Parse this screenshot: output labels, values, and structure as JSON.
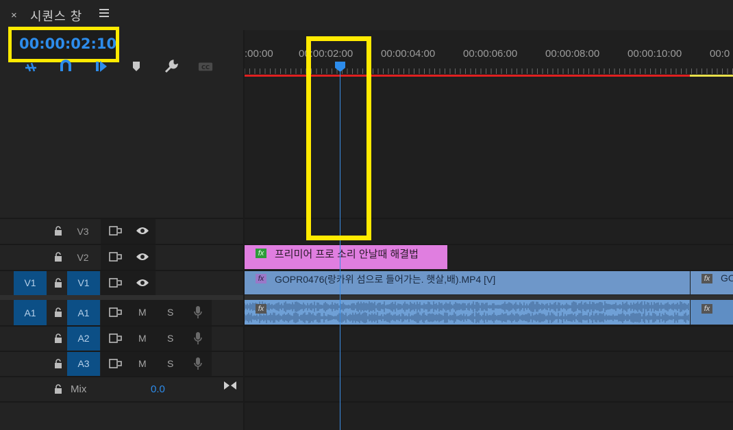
{
  "panel": {
    "close_label": "×",
    "title": "시퀀스 창",
    "timecode": "00:00:02:10"
  },
  "ruler": {
    "labels": [
      ":00:00",
      "00:00:02:00",
      "00:00:04:00",
      "00:00:06:00",
      "00:00:08:00",
      "00:00:10:00",
      "00:0"
    ]
  },
  "tracks": {
    "v3": {
      "name": "V3"
    },
    "v2": {
      "name": "V2"
    },
    "v1": {
      "target": "V1",
      "name": "V1"
    },
    "a1": {
      "target": "A1",
      "name": "A1",
      "mute": "M",
      "solo": "S"
    },
    "a2": {
      "name": "A2",
      "mute": "M",
      "solo": "S"
    },
    "a3": {
      "name": "A3",
      "mute": "M",
      "solo": "S"
    },
    "mix": {
      "label": "Mix",
      "value": "0.0"
    }
  },
  "clips": {
    "title_clip": {
      "fx": "fx",
      "label": "프리미어 프로 소리 안날때 해결법"
    },
    "video_clip": {
      "fx": "fx",
      "label": "GOPR0476(랑카위 섬으로 들어가는. 햇살,배).MP4 [V]"
    },
    "video_clip_2": {
      "fx": "fx",
      "label": "GO"
    },
    "audio_clip": {
      "fx": "fx"
    },
    "audio_clip_2": {
      "fx": "fx"
    }
  },
  "colors": {
    "accent": "#2d8ceb",
    "highlight": "#ffea00",
    "title_clip": "#e07ee0",
    "video_clip": "#6e97c9",
    "audio_clip": "#6fa0d6",
    "target_track": "#0c4f86"
  },
  "icons": [
    "close-icon",
    "menu-icon",
    "snap-icon",
    "magnet-icon",
    "select-icon",
    "marker-icon",
    "wrench-icon",
    "captions-icon",
    "lock-icon",
    "sync-icon",
    "eye-icon",
    "mic-icon",
    "mix-icon"
  ]
}
